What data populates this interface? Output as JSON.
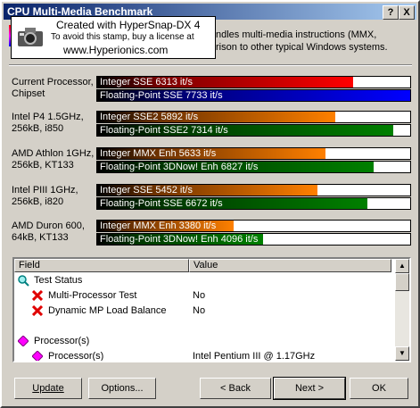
{
  "window": {
    "title": "CPU Multi-Media Benchmark",
    "help_button": "?",
    "close_button": "X"
  },
  "stamp": {
    "line1": "Created with HyperSnap-DX 4",
    "line2": "To avoid this stamp, buy a license at",
    "line3": "www.Hyperionics.com"
  },
  "description": {
    "line1": "ndles multi-media instructions (MMX,",
    "line2": "rison to other typical Windows systems."
  },
  "rows": [
    {
      "label1": "Current Processor,",
      "label2": "Chipset",
      "bars": [
        {
          "text": "Integer SSE 6313 it/s",
          "value": 6313,
          "color": "red"
        },
        {
          "text": "Floating-Point SSE 7733 it/s",
          "value": 7733,
          "color": "blue"
        }
      ]
    },
    {
      "label1": "Intel P4 1.5GHz,",
      "label2": "256kB, i850",
      "bars": [
        {
          "text": "Integer SSE2 5892 it/s",
          "value": 5892,
          "color": "orange"
        },
        {
          "text": "Floating-Point SSE2 7314 it/s",
          "value": 7314,
          "color": "green"
        }
      ]
    },
    {
      "label1": "AMD Athlon 1GHz,",
      "label2": "256kB, KT133",
      "bars": [
        {
          "text": "Integer MMX Enh 5633 it/s",
          "value": 5633,
          "color": "orange"
        },
        {
          "text": "Floating-Point 3DNow! Enh 6827 it/s",
          "value": 6827,
          "color": "green"
        }
      ]
    },
    {
      "label1": "Intel PIII 1GHz,",
      "label2": "256kB, i820",
      "bars": [
        {
          "text": "Integer SSE 5452 it/s",
          "value": 5452,
          "color": "orange"
        },
        {
          "text": "Floating-Point SSE 6672 it/s",
          "value": 6672,
          "color": "green"
        }
      ]
    },
    {
      "label1": "AMD Duron 600,",
      "label2": "64kB, KT133",
      "bars": [
        {
          "text": "Integer MMX Enh 3380 it/s",
          "value": 3380,
          "color": "orange"
        },
        {
          "text": "Floating-Point 3DNow! Enh 4096 it/s",
          "value": 4096,
          "color": "green"
        }
      ]
    }
  ],
  "scale_max": 7733,
  "list": {
    "col_field": "Field",
    "col_value": "Value",
    "items": [
      {
        "field": "Test Status",
        "value": "",
        "icon": "magnifier-icon",
        "indent": 0
      },
      {
        "field": "Multi-Processor Test",
        "value": "No",
        "icon": "red-x-icon",
        "indent": 1
      },
      {
        "field": "Dynamic MP Load Balance",
        "value": "No",
        "icon": "red-x-icon",
        "indent": 1
      },
      {
        "field": "",
        "value": "",
        "icon": "",
        "indent": 0
      },
      {
        "field": "Processor(s)",
        "value": "",
        "icon": "diamond-icon",
        "indent": 0
      },
      {
        "field": "Processor(s)",
        "value": "Intel Pentium III @ 1.17GHz",
        "icon": "diamond-icon",
        "indent": 1
      }
    ]
  },
  "buttons": {
    "update": "Update",
    "options": "Options...",
    "back": "< Back",
    "next": "Next >",
    "ok": "OK"
  },
  "colors": {
    "red": "#ff0000",
    "blue": "#0000ff",
    "orange": "#ff8000",
    "green": "#008000"
  }
}
